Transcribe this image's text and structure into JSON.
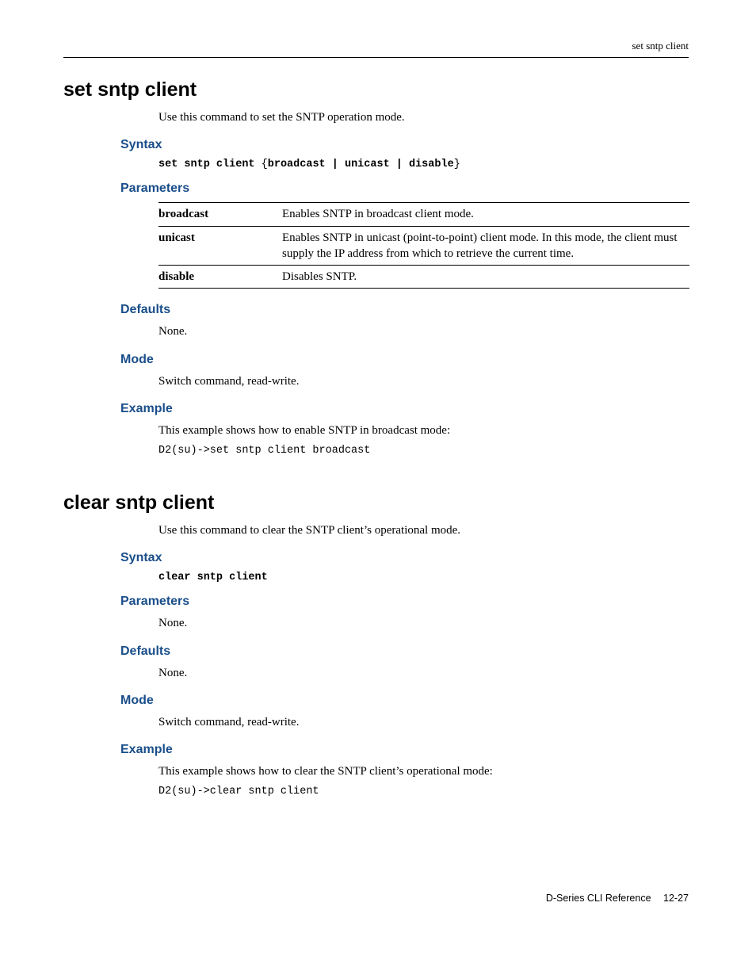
{
  "header": {
    "running_head": "set sntp client"
  },
  "sections": {
    "set": {
      "title": "set sntp client",
      "intro": "Use this command to set the SNTP operation mode.",
      "syntax_heading": "Syntax",
      "syntax_cmd": "set sntp client",
      "syntax_args": "broadcast | unicast | disable",
      "parameters_heading": "Parameters",
      "params": {
        "broadcast": {
          "key": "broadcast",
          "desc": "Enables SNTP in broadcast client mode."
        },
        "unicast": {
          "key": "unicast",
          "desc": "Enables SNTP in unicast (point-to-point) client mode. In this mode, the client must supply the IP address from which to retrieve the current time."
        },
        "disable": {
          "key": "disable",
          "desc": "Disables SNTP."
        }
      },
      "defaults_heading": "Defaults",
      "defaults_text": "None.",
      "mode_heading": "Mode",
      "mode_text": "Switch command, read-write.",
      "example_heading": "Example",
      "example_text": "This example shows how to enable SNTP in broadcast mode:",
      "example_code": "D2(su)->set sntp client broadcast"
    },
    "clear": {
      "title": "clear sntp client",
      "intro": "Use this command to clear the SNTP client’s operational mode.",
      "syntax_heading": "Syntax",
      "syntax_cmd": "clear sntp client",
      "parameters_heading": "Parameters",
      "parameters_text": "None.",
      "defaults_heading": "Defaults",
      "defaults_text": "None.",
      "mode_heading": "Mode",
      "mode_text": "Switch command, read-write.",
      "example_heading": "Example",
      "example_text": "This example shows how to clear the SNTP client’s operational mode:",
      "example_code": "D2(su)->clear sntp client"
    }
  },
  "footer": {
    "doc": "D-Series CLI Reference",
    "page": "12-27"
  }
}
